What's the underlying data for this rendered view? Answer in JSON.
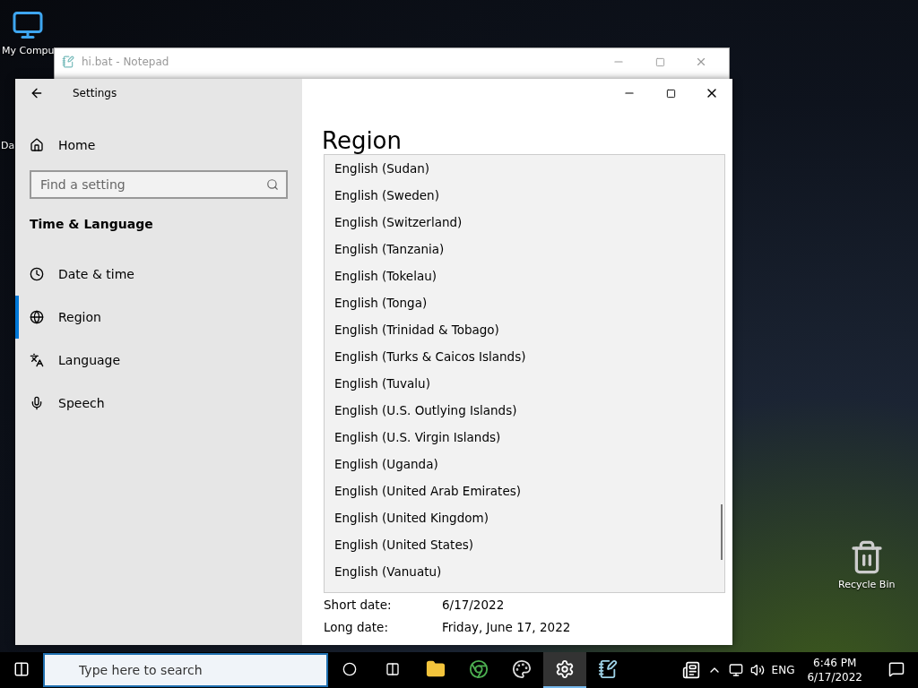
{
  "desktop_icons": [
    {
      "kind": "computer",
      "label": "My Compu"
    },
    {
      "kind": "partial",
      "label": "Da"
    },
    {
      "kind": "recycle",
      "label": "Recycle Bin"
    }
  ],
  "notepad": {
    "title": "hi.bat - Notepad"
  },
  "settings": {
    "title": "Settings",
    "home": "Home",
    "search": {
      "placeholder": "Find a setting"
    },
    "section": "Time & Language",
    "nav": [
      {
        "kind": "clock",
        "label": "Date & time",
        "selected": false
      },
      {
        "kind": "globe",
        "label": "Region",
        "selected": true
      },
      {
        "kind": "language",
        "label": "Language",
        "selected": false
      },
      {
        "kind": "mic",
        "label": "Speech",
        "selected": false
      }
    ],
    "page_title": "Region",
    "dropdown_items": [
      {
        "label": "English (Sudan)",
        "selected": false
      },
      {
        "label": "English (Sweden)",
        "selected": false
      },
      {
        "label": "English (Switzerland)",
        "selected": false
      },
      {
        "label": "English (Tanzania)",
        "selected": false
      },
      {
        "label": "English (Tokelau)",
        "selected": false
      },
      {
        "label": "English (Tonga)",
        "selected": false
      },
      {
        "label": "English (Trinidad & Tobago)",
        "selected": false
      },
      {
        "label": "English (Turks & Caicos Islands)",
        "selected": false
      },
      {
        "label": "English (Tuvalu)",
        "selected": false
      },
      {
        "label": "English (U.S. Outlying Islands)",
        "selected": false
      },
      {
        "label": "English (U.S. Virgin Islands)",
        "selected": false
      },
      {
        "label": "English (Uganda)",
        "selected": false
      },
      {
        "label": "English (United Arab Emirates)",
        "selected": false
      },
      {
        "label": "English (United Kingdom)",
        "selected": false
      },
      {
        "label": "English (United States)",
        "selected": false
      },
      {
        "label": "English (Vanuatu)",
        "selected": false
      }
    ],
    "formats": [
      {
        "label": "Short date:",
        "value": "6/17/2022"
      },
      {
        "label": "Long date:",
        "value": "Friday, June 17, 2022"
      }
    ]
  },
  "taskbar": {
    "search_placeholder": "Type here to search",
    "apps": [
      {
        "kind": "explorer",
        "selected": false
      },
      {
        "kind": "chrome",
        "selected": false
      },
      {
        "kind": "paint",
        "selected": false
      },
      {
        "kind": "settings",
        "selected": true
      },
      {
        "kind": "notepad",
        "selected": false
      }
    ],
    "language": "ENG",
    "time": "6:46 PM",
    "date": "6/17/2022"
  }
}
